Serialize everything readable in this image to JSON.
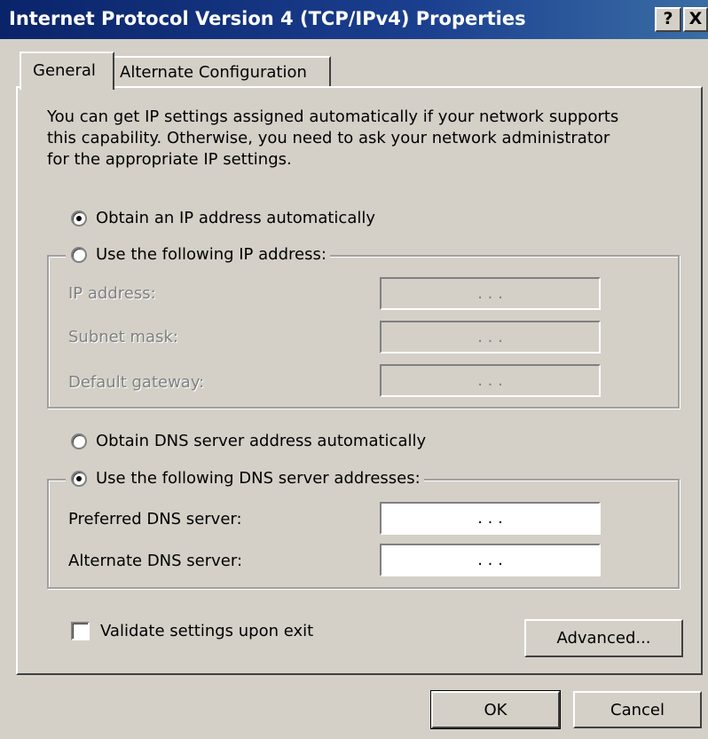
{
  "window": {
    "title": "Internet Protocol Version 4 (TCP/IPv4) Properties",
    "help_label": "?",
    "close_label": "X"
  },
  "tabs": [
    {
      "label": "General",
      "selected": true
    },
    {
      "label": "Alternate Configuration",
      "selected": false
    }
  ],
  "description": [
    "You can get IP settings assigned automatically if your network supports",
    "this capability. Otherwise, you need to ask your network administrator",
    "for the appropriate IP settings."
  ],
  "ip_mode": {
    "auto_label": "Obtain an IP address automatically",
    "auto_selected": true,
    "manual_label": "Use the following IP address:",
    "manual_selected": false
  },
  "ip_fields": [
    {
      "label": "IP address:",
      "value": ". . ."
    },
    {
      "label": "Subnet mask:",
      "value": ". . ."
    },
    {
      "label": "Default gateway:",
      "value": ". . ."
    }
  ],
  "dns_mode": {
    "auto_label": "Obtain DNS server address automatically",
    "auto_selected": false,
    "manual_label": "Use the following DNS server addresses:",
    "manual_selected": true
  },
  "dns_fields": [
    {
      "label": "Preferred DNS server:",
      "value": ". . ."
    },
    {
      "label": "Alternate DNS server:",
      "value": ". . ."
    }
  ],
  "validate": {
    "label": "Validate settings upon exit",
    "checked": false
  },
  "buttons": {
    "advanced": "Advanced...",
    "ok": "OK",
    "cancel": "Cancel"
  }
}
